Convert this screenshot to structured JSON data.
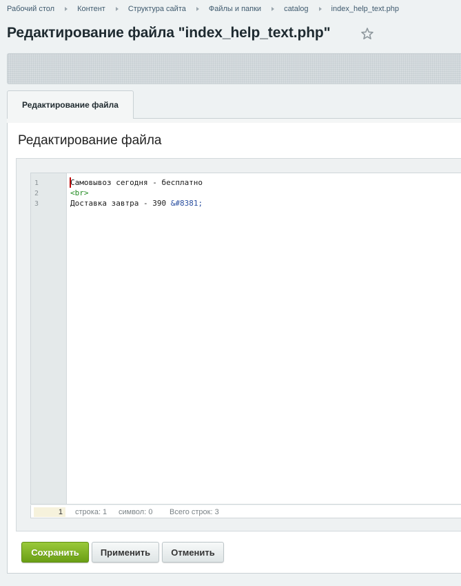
{
  "breadcrumb": {
    "items": [
      "Рабочий стол",
      "Контент",
      "Структура сайта",
      "Файлы и папки",
      "catalog",
      "index_help_text.php"
    ]
  },
  "page": {
    "title": "Редактирование файла \"index_help_text.php\"",
    "favorite_icon": "star-outline-icon"
  },
  "tabs": [
    {
      "label": "Редактирование файла",
      "active": true
    }
  ],
  "section": {
    "title": "Редактирование файла"
  },
  "editor": {
    "line_numbers": [
      "1",
      "2",
      "3"
    ],
    "lines": [
      {
        "text": "Самовывоз сегодня - бесплатно"
      },
      {
        "tag": "<br>"
      },
      {
        "text": "Доставка завтра - 390 ",
        "entity": "&#8381;"
      }
    ],
    "status": {
      "goto_line": "1",
      "line_label": "строка: 1",
      "char_label": "символ: 0",
      "total_label": "Всего строк: 3"
    }
  },
  "buttons": {
    "save": "Сохранить",
    "apply": "Применить",
    "cancel": "Отменить"
  },
  "colors": {
    "accent_green": "#7fb221",
    "cursor": "#c00000",
    "tag_green": "#1f8a1f",
    "entity_blue": "#2a4fa0"
  }
}
